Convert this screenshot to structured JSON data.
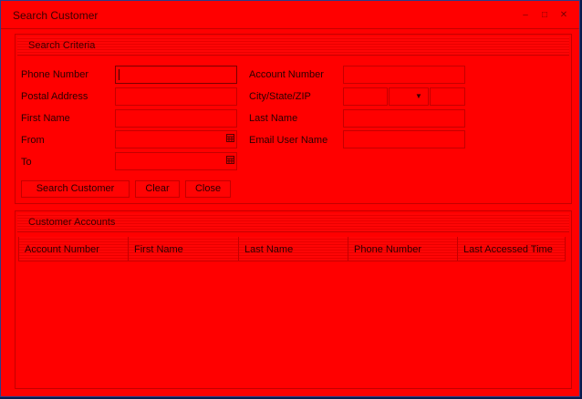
{
  "window": {
    "title": "Search Customer",
    "minimize_glyph": "–",
    "maximize_glyph": "□",
    "close_glyph": "✕"
  },
  "search_criteria": {
    "title": "Search Criteria",
    "labels": {
      "phone": "Phone Number",
      "account": "Account Number",
      "postal": "Postal Address",
      "city_state_zip": "City/State/ZIP",
      "first_name": "First Name",
      "last_name": "Last Name",
      "from": "From",
      "email": "Email User Name",
      "to": "To"
    },
    "values": {
      "phone": "",
      "account": "",
      "postal": "",
      "city": "",
      "state": "",
      "zip": "",
      "first_name": "",
      "last_name": "",
      "from": "",
      "email": "",
      "to": ""
    },
    "state_dropdown_glyph": "▼",
    "calendar_icon": "calendar-icon",
    "buttons": {
      "search": "Search Customer",
      "clear": "Clear",
      "close": "Close"
    }
  },
  "customer_accounts": {
    "title": "Customer Accounts",
    "columns": [
      "Account Number",
      "First Name",
      "Last Name",
      "Phone Number",
      "Last Accessed Time"
    ],
    "rows": []
  },
  "colors": {
    "background": "#ff0000",
    "border": "#c40000",
    "text": "#2a0000",
    "frame": "#0a1a4a"
  }
}
